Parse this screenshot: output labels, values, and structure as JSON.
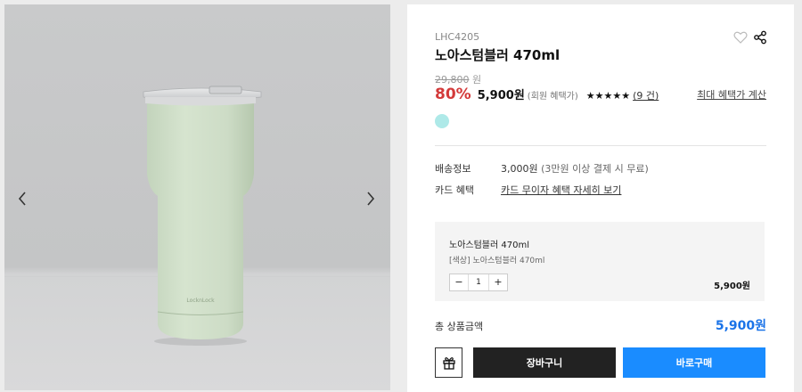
{
  "gallery": {
    "prev_icon": "chevron-left-icon",
    "next_icon": "chevron-right-icon",
    "product_brand_mark": "LocknLock"
  },
  "product": {
    "code": "LHC4205",
    "name": "노아스텀블러 470ml",
    "original_price": "29,800",
    "original_price_unit": "원",
    "discount": "80%",
    "sale_price": "5,900원",
    "member_note": "(회원 혜택가)",
    "stars": "★★★★★",
    "rating": 5,
    "review_count": "(9 건)",
    "max_benefit_link": "최대 혜택가 계산",
    "color_swatch": "#aee9e8",
    "wishlist_icon": "heart-icon",
    "share_icon": "share-icon"
  },
  "info": {
    "shipping_label": "배송정보",
    "shipping_value": "3,000원",
    "shipping_note": "(3만원 이상 결제 시 무료)",
    "card_label": "카드 혜택",
    "card_value": "카드 무이자 혜택 자세히 보기"
  },
  "option": {
    "title": "노아스텀블러 470ml",
    "subtitle": "[색상] 노아스텀블러 470ml",
    "minus": "−",
    "quantity": "1",
    "plus": "+",
    "price": "5,900원"
  },
  "total": {
    "label": "총 상품금액",
    "value": "5,900원"
  },
  "actions": {
    "gift_icon": "gift-icon",
    "cart_label": "장바구니",
    "buy_label": "바로구매"
  },
  "colors": {
    "discount": "#d33a3a",
    "total": "#1a73e8",
    "buy_button": "#1a8cff",
    "cart_button": "#222222",
    "product_body": "#d0dfc9"
  }
}
